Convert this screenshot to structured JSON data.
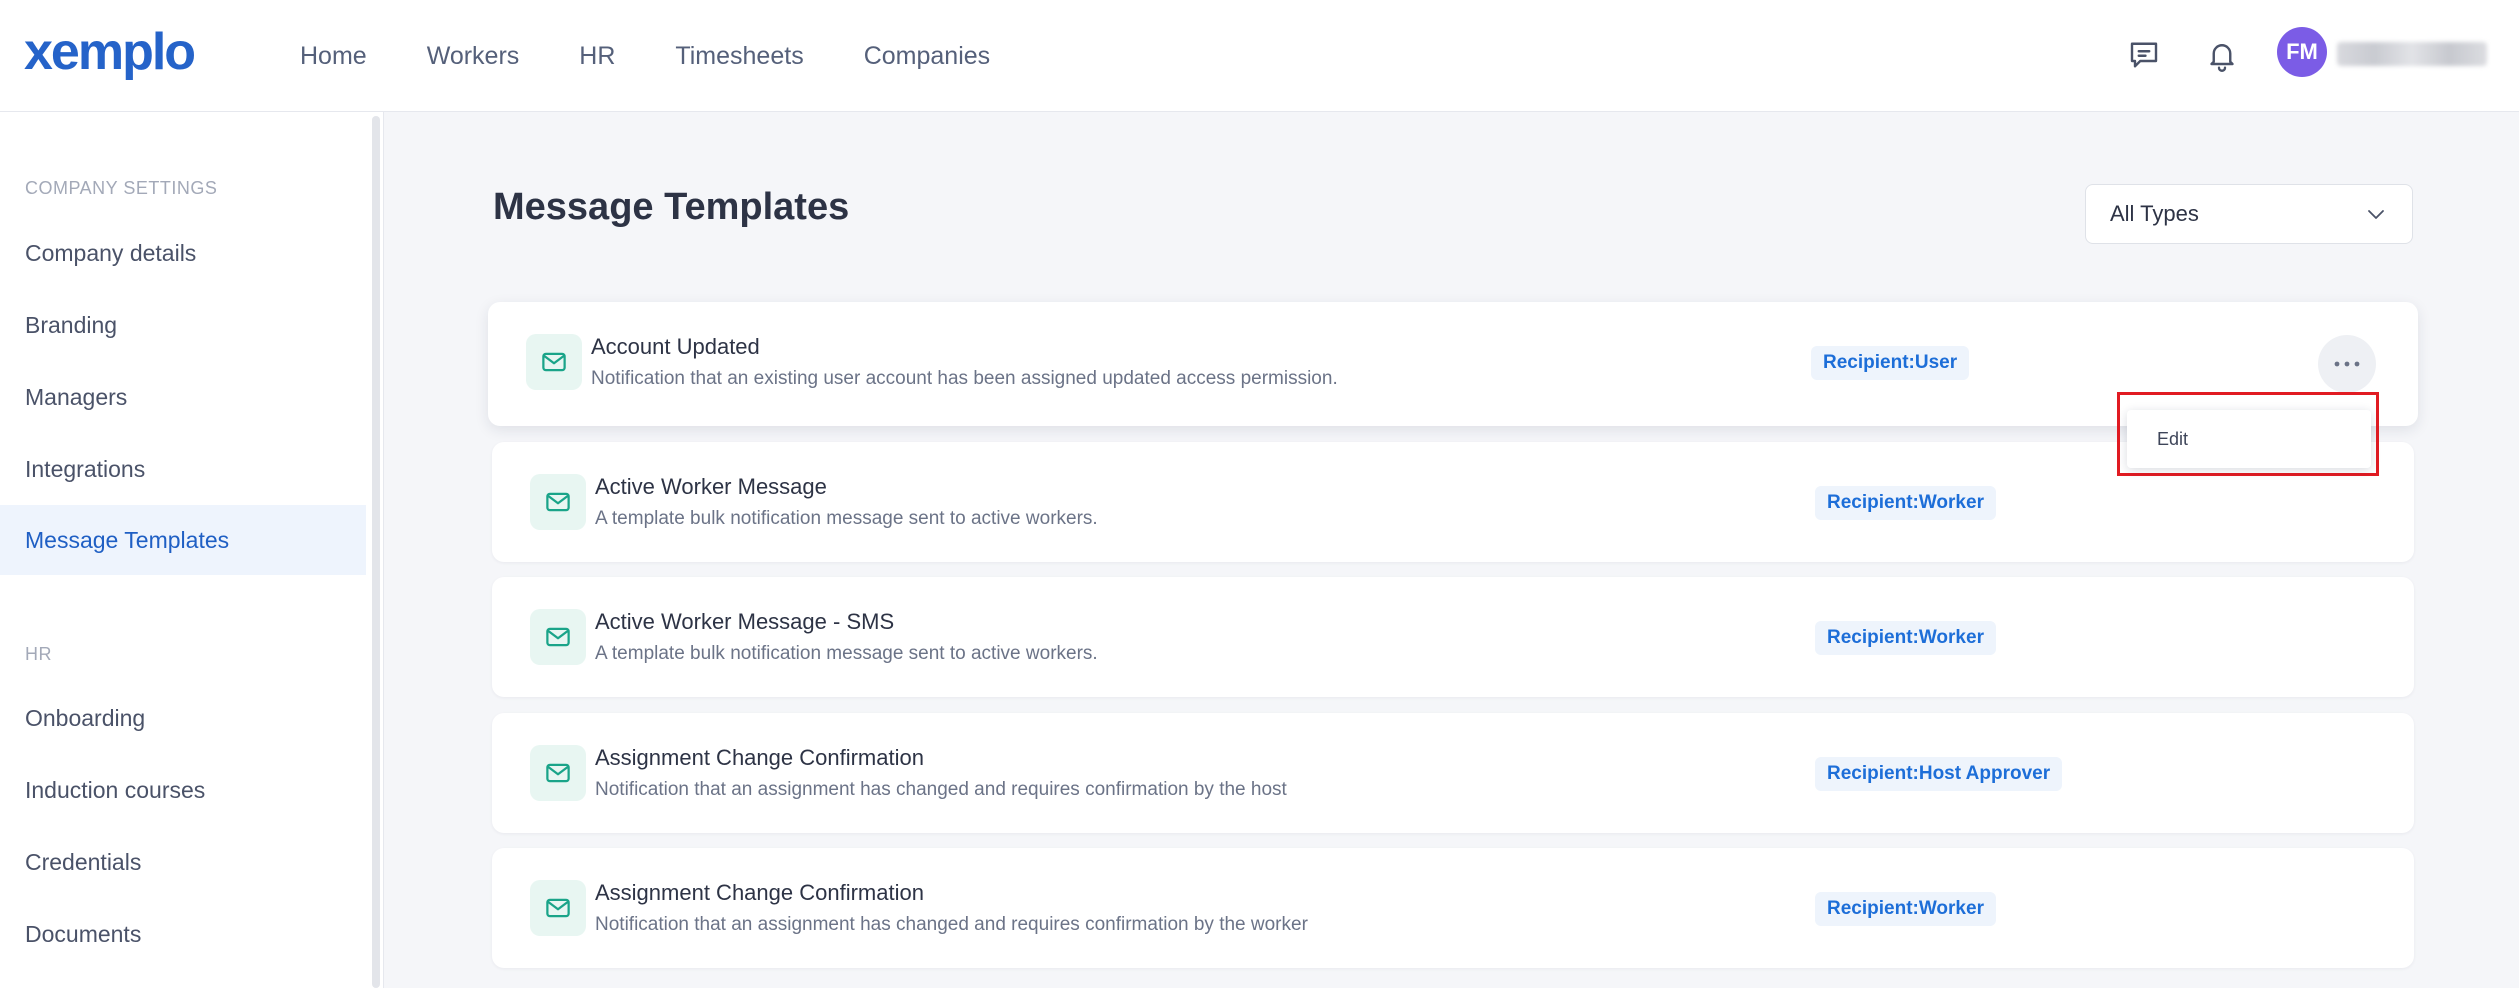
{
  "app": {
    "logo": "xemplo",
    "user_initials": "FM"
  },
  "nav": {
    "items": [
      "Home",
      "Workers",
      "HR",
      "Timesheets",
      "Companies"
    ]
  },
  "icons": {
    "chat": "chat-bubble-icon",
    "notifications": "bell-icon",
    "template": "envelope-icon",
    "more": "more-horizontal-icon",
    "select": "chevron-down-icon"
  },
  "sidebar": {
    "company_settings_title": "COMPANY SETTINGS",
    "company_settings": [
      "Company details",
      "Branding",
      "Managers",
      "Integrations",
      "Message Templates"
    ],
    "active_item": "Message Templates",
    "hr_title": "HR",
    "hr": [
      "Onboarding",
      "Induction courses",
      "Credentials",
      "Documents"
    ]
  },
  "main": {
    "title": "Message Templates",
    "type_filter": "All Types",
    "templates": [
      {
        "title": "Account Updated",
        "description": "Notification that an existing user account has been assigned updated access permission.",
        "recipient": "Recipient:User"
      },
      {
        "title": "Active Worker Message",
        "description": "A template bulk notification message sent to active workers.",
        "recipient": "Recipient:Worker"
      },
      {
        "title": "Active Worker Message - SMS",
        "description": "A template bulk notification message sent to active workers.",
        "recipient": "Recipient:Worker"
      },
      {
        "title": "Assignment Change Confirmation",
        "description": "Notification that an assignment has changed and requires confirmation by the host",
        "recipient": "Recipient:Host Approver"
      },
      {
        "title": "Assignment Change Confirmation",
        "description": "Notification that an assignment has changed and requires confirmation by the worker",
        "recipient": "Recipient:Worker"
      }
    ],
    "menu": {
      "edit_label": "Edit"
    }
  },
  "colors": {
    "brand": "#2563c9",
    "active_nav": "#1f5fc4",
    "badge_text": "#1d6ed8",
    "icon_accent": "#1aa489",
    "highlight": "#e11b22",
    "avatar": "#7b5ce6"
  }
}
